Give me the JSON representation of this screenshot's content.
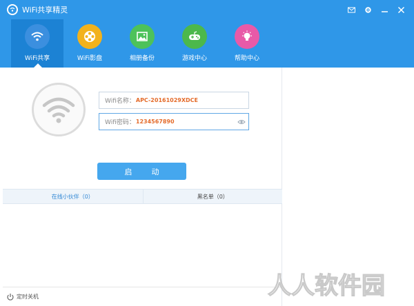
{
  "window": {
    "title": "WiFi共享精灵"
  },
  "titlebar": {
    "icons": [
      "mail-icon",
      "gear-icon",
      "minimize-icon",
      "close-icon"
    ]
  },
  "toolbar": {
    "items": [
      {
        "label": "WiFi共享",
        "icon": "wifi-icon",
        "color": "#3b8fdf"
      },
      {
        "label": "WiFi影盘",
        "icon": "film-reel-icon",
        "color": "#f2b21c"
      },
      {
        "label": "相册备份",
        "icon": "photo-icon",
        "color": "#4dc25a"
      },
      {
        "label": "游戏中心",
        "icon": "gamepad-icon",
        "color": "#4cb84c"
      },
      {
        "label": "帮助中心",
        "icon": "lightbulb-icon",
        "color": "#e85aa8"
      }
    ]
  },
  "form": {
    "name_label": "Wifi名称：",
    "name_value": "APC-20161029XDCE",
    "password_label": "Wifi密码：",
    "password_value": "1234567890"
  },
  "start_button": "启动",
  "tabs": [
    "在线小伙伴（0）",
    "黑名单（0）"
  ],
  "footer": {
    "timer_label": "定时关机"
  },
  "watermark": {
    "text": "人人软件园"
  },
  "colors": {
    "brand": "#2f97e8",
    "accent_value": "#e46b2a",
    "button": "#45a7ee"
  }
}
